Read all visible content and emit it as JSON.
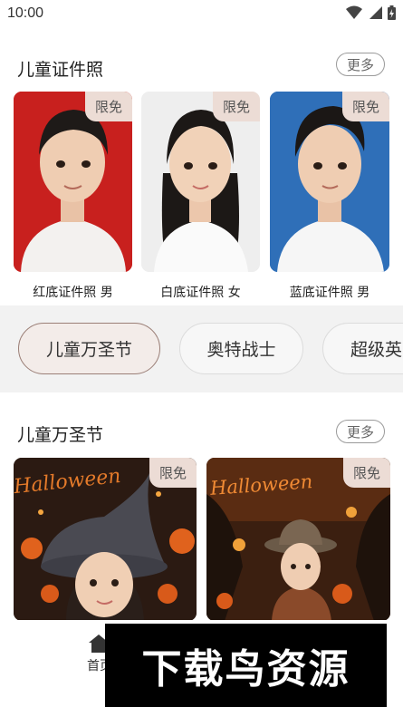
{
  "status_bar": {
    "time": "10:00"
  },
  "id_photos": {
    "title": "儿童证件照",
    "more_label": "更多",
    "cards": [
      {
        "badge": "限免",
        "label": "红底证件照 男",
        "bg": "#c8201e"
      },
      {
        "badge": "限免",
        "label": "白底证件照 女",
        "bg": "#f1f1f1"
      },
      {
        "badge": "限免",
        "label": "蓝底证件照 男",
        "bg": "#2f6fb8"
      }
    ]
  },
  "category_tabs": [
    {
      "label": "儿童万圣节"
    },
    {
      "label": "奥特战士"
    },
    {
      "label": "超级英"
    }
  ],
  "halloween": {
    "title": "儿童万圣节",
    "more_label": "更多",
    "cards": [
      {
        "badge": "限免",
        "art_text": "Halloween"
      },
      {
        "badge": "限免",
        "art_text": "Halloween"
      }
    ]
  },
  "bottom_nav": {
    "home_label": "首页"
  },
  "watermark": {
    "text": "下载鸟资源"
  }
}
